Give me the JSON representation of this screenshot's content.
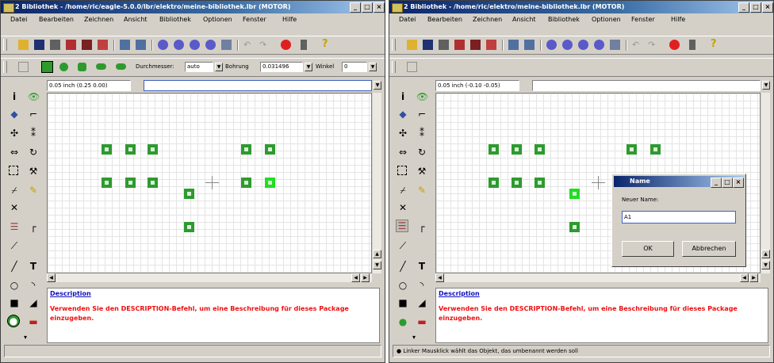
{
  "left": {
    "title": "2 Bibliothek - /home/ric/eagle-5.0.0/lbr/elektro/meine-bibliothek.lbr (MOTOR)",
    "menu": [
      "Datei",
      "Bearbeiten",
      "Zeichnen",
      "Ansicht",
      "Bibliothek",
      "Optionen",
      "Fenster",
      "Hilfe"
    ],
    "param_toolbar": {
      "durchmesser_label": "Durchmesser:",
      "durchmesser_value": "auto",
      "bohrung_label": "Bohrung",
      "bohrung_value": "0.031496",
      "winkel_label": "Winkel",
      "winkel_value": "0"
    },
    "coord": "0.05 inch (0.25 0.00)",
    "command_value": "",
    "description_title": "Description",
    "description_text": "Verwenden Sie den DESCRIPTION-Befehl, um eine Beschreibung für dieses Package einzugeben.",
    "status": ""
  },
  "right": {
    "title": "2 Bibliothek - /home/ric/elektro/meine-bibliothek.lbr (MOTOR)",
    "menu": [
      "Datei",
      "Bearbeiten",
      "Zeichnen",
      "Ansicht",
      "Bibliothek",
      "Optionen",
      "Fenster",
      "Hilfe"
    ],
    "coord": "0.05 inch (-0.10 -0.05)",
    "command_value": "",
    "description_title": "Description",
    "description_text": "Verwenden Sie den DESCRIPTION-Befehl, um eine Beschreibung für dieses Package einzugeben.",
    "status": "● Linker Mausklick wählt das Objekt, das umbenannt werden soll"
  },
  "dialog": {
    "title": "Name",
    "label": "Neuer Name:",
    "value": "A1",
    "ok": "OK",
    "cancel": "Abbrechen"
  },
  "colors": {
    "pad": "#2e9a2e",
    "pad_selected": "#22dd22",
    "description_title": "#1010c0",
    "description_text": "#ee1010"
  }
}
